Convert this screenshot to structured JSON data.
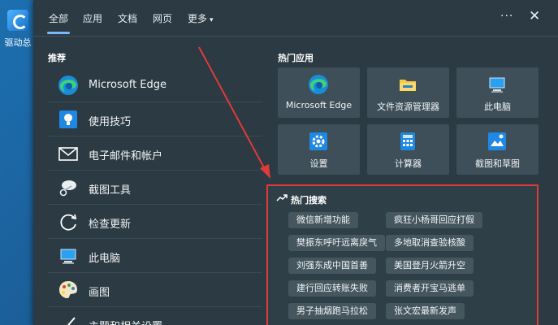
{
  "desktop": {
    "icon_label": "驱动总"
  },
  "tabs": [
    {
      "label": "全部",
      "active": true
    },
    {
      "label": "应用"
    },
    {
      "label": "文档"
    },
    {
      "label": "网页"
    },
    {
      "label": "更多"
    }
  ],
  "more_caret": "▾",
  "header_actions": {
    "more": "···",
    "close": "✕"
  },
  "recommend": {
    "title": "推荐",
    "items": [
      {
        "label": "Microsoft Edge",
        "icon": "edge-icon"
      },
      {
        "label": "使用技巧",
        "icon": "lightbulb-icon"
      },
      {
        "label": "电子邮件和帐户",
        "icon": "mail-icon"
      },
      {
        "label": "截图工具",
        "icon": "snipping-tool-icon"
      },
      {
        "label": "检查更新",
        "icon": "refresh-icon"
      },
      {
        "label": "此电脑",
        "icon": "computer-icon"
      },
      {
        "label": "画图",
        "icon": "paint-palette-icon"
      },
      {
        "label": "主题和相关设置",
        "icon": "brush-icon"
      }
    ]
  },
  "hot_apps": {
    "title": "热门应用",
    "tiles": [
      {
        "label": "Microsoft Edge",
        "icon": "edge-icon"
      },
      {
        "label": "文件资源管理器",
        "icon": "folder-icon"
      },
      {
        "label": "此电脑",
        "icon": "computer-icon"
      },
      {
        "label": "设置",
        "icon": "gear-icon"
      },
      {
        "label": "计算器",
        "icon": "calculator-icon"
      },
      {
        "label": "截图和草图",
        "icon": "snip-sketch-icon"
      }
    ]
  },
  "hot_search": {
    "title": "热门搜索",
    "icon": "trending-icon",
    "chips": [
      [
        "微信新增功能",
        "疯狂小杨哥回应打假"
      ],
      [
        "樊振东呼吁远离戾气",
        "多地取消查验核酸"
      ],
      [
        "刘强东成中国首善",
        "美国登月火箭升空"
      ],
      [
        "建行回应转账失败",
        "消费者开宝马逃单"
      ],
      [
        "男子抽烟跑马拉松",
        "张文宏最新发声"
      ]
    ]
  },
  "colors": {
    "panel_bg": "#2b3a43",
    "tile_bg": "#3e4f59",
    "accent": "#79b8ff",
    "highlight_border": "#e13a3a"
  }
}
